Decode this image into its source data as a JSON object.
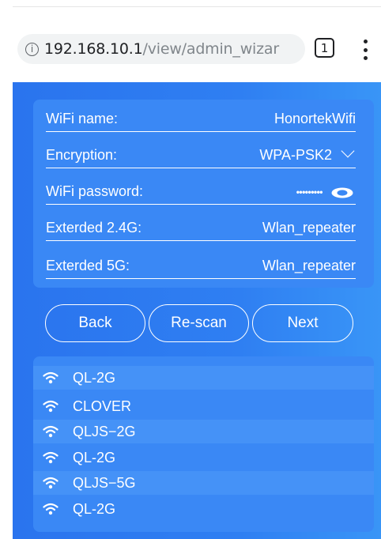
{
  "browser": {
    "url_host": "192.168.10.1",
    "url_path": "/view/admin_wizar",
    "tab_count": "1"
  },
  "form": {
    "wifi_name": {
      "label": "WiFi name:",
      "value": "HonortekWifi"
    },
    "encryption": {
      "label": "Encryption:",
      "value": "WPA-PSK2"
    },
    "wifi_password": {
      "label": "WiFi password:",
      "value": "•••••••••"
    },
    "extended_24g": {
      "label": "Exterded 2.4G:",
      "value": "Wlan_repeater"
    },
    "extended_5g": {
      "label": "Exterded 5G:",
      "value": "Wlan_repeater"
    }
  },
  "buttons": {
    "back": "Back",
    "rescan": "Re-scan",
    "next": "Next"
  },
  "scan_list": [
    {
      "ssid": "QL-2G",
      "icon": "wifi-icon"
    },
    {
      "ssid": "CLOVER",
      "icon": "wifi-icon"
    },
    {
      "ssid": "QLJS−2G",
      "icon": "wifi-icon"
    },
    {
      "ssid": "QL-2G",
      "icon": "wifi-icon"
    },
    {
      "ssid": "QLJS−5G",
      "icon": "wifi-icon"
    },
    {
      "ssid": "QL-2G",
      "icon": "wifi-icon"
    }
  ],
  "colors": {
    "page_blue": "#2f7ff2",
    "panel_blue": "#3a88f5",
    "row_highlight": "#4592f7"
  }
}
